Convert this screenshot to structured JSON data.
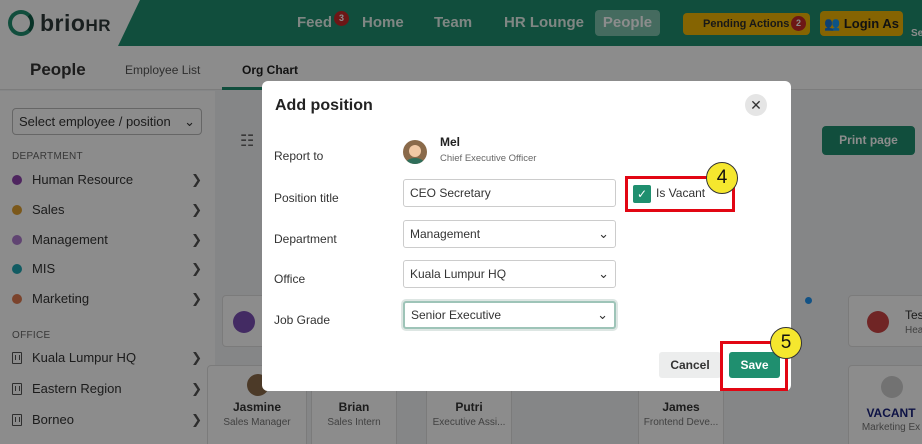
{
  "app": {
    "logo_main": "brio",
    "logo_sub": "HR"
  },
  "nav": {
    "items": [
      {
        "label": "Feed",
        "badge": "3"
      },
      {
        "label": "Home"
      },
      {
        "label": "Team"
      },
      {
        "label": "HR Lounge"
      },
      {
        "label": "People",
        "active": true
      }
    ],
    "pending_label": "Pending Actions",
    "pending_count": "2",
    "login_label": "Login As",
    "truncated_right": "Se"
  },
  "subheader": {
    "title": "People",
    "tabs": [
      {
        "label": "Employee List"
      },
      {
        "label": "Org Chart",
        "active": true
      }
    ]
  },
  "sidebar": {
    "select_placeholder": "Select employee / position",
    "department_heading": "DEPARTMENT",
    "departments": [
      {
        "label": "Human Resource",
        "color": "#8e44ad"
      },
      {
        "label": "Sales",
        "color": "#e0a030"
      },
      {
        "label": "Management",
        "color": "#b07cd0"
      },
      {
        "label": "MIS",
        "color": "#1fa7b3"
      },
      {
        "label": "Marketing",
        "color": "#e07b50"
      }
    ],
    "office_heading": "OFFICE",
    "offices": [
      {
        "label": "Kuala Lumpur HQ"
      },
      {
        "label": "Eastern Region"
      },
      {
        "label": "Borneo"
      }
    ]
  },
  "main": {
    "print_label": "Print page",
    "cards_top": [
      {
        "name": "Tes",
        "role": "Hea"
      }
    ],
    "cards_bottom": [
      {
        "name": "Jasmine",
        "role": "Sales Manager"
      },
      {
        "name": "Brian",
        "role": "Sales Intern"
      },
      {
        "name": "Putri",
        "role": "Executive Assi..."
      },
      {
        "name": "James",
        "role": "Frontend Deve..."
      },
      {
        "name": "VACANT",
        "role": "Marketing Ex"
      }
    ]
  },
  "modal": {
    "title": "Add position",
    "labels": {
      "report_to": "Report to",
      "position_title": "Position title",
      "department": "Department",
      "office": "Office",
      "job_grade": "Job Grade"
    },
    "report_to": {
      "name": "Mel",
      "title": "Chief Executive Officer"
    },
    "position_title_value": "CEO Secretary",
    "is_vacant_label": "Is Vacant",
    "is_vacant_checked": true,
    "department_value": "Management",
    "office_value": "Kuala Lumpur HQ",
    "job_grade_value": "Senior Executive",
    "cancel_label": "Cancel",
    "save_label": "Save"
  },
  "annotations": {
    "step_vacant": "4",
    "step_save": "5"
  }
}
